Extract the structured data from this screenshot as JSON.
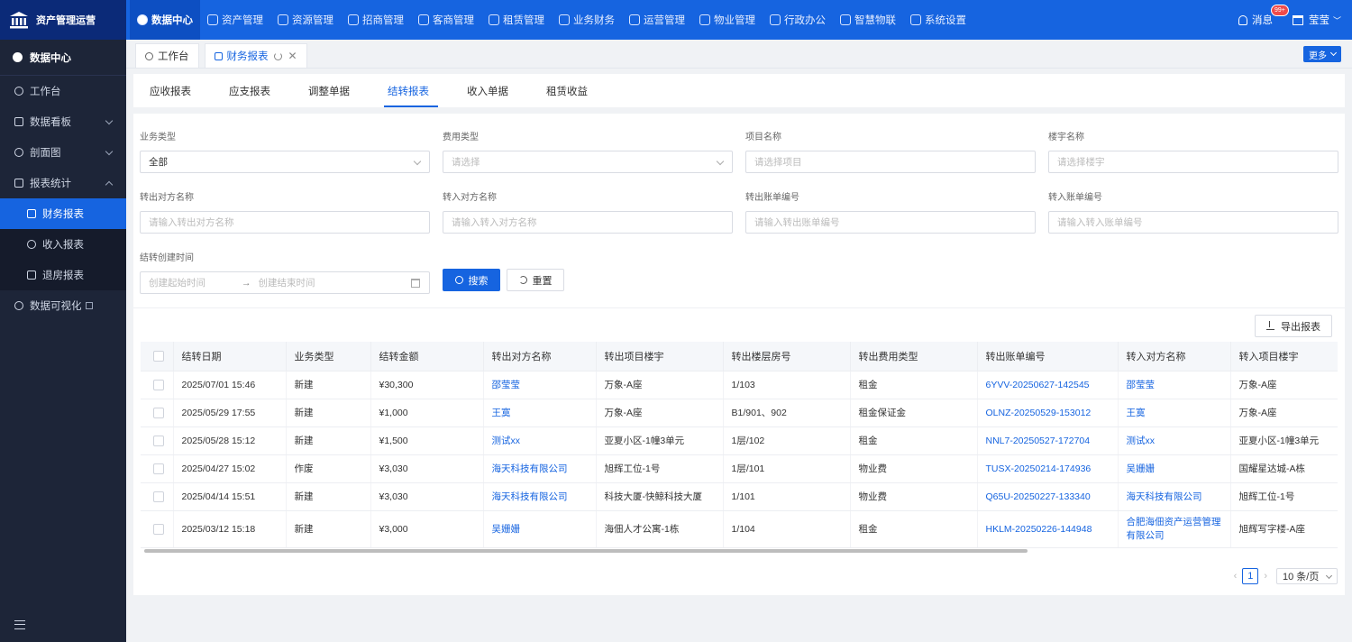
{
  "app": {
    "name": "资产管理运营"
  },
  "topnav": [
    {
      "label": "数据中心",
      "icon": "pie-chart-icon",
      "active": true
    },
    {
      "label": "资产管理",
      "icon": "cube-icon"
    },
    {
      "label": "资源管理",
      "icon": "building-icon"
    },
    {
      "label": "招商管理",
      "icon": "tag-icon"
    },
    {
      "label": "客商管理",
      "icon": "users-icon"
    },
    {
      "label": "租赁管理",
      "icon": "house-icon"
    },
    {
      "label": "业务财务",
      "icon": "coin-icon"
    },
    {
      "label": "运营管理",
      "icon": "image-icon"
    },
    {
      "label": "物业管理",
      "icon": "home-icon"
    },
    {
      "label": "行政办公",
      "icon": "monitor-icon"
    },
    {
      "label": "智慧物联",
      "icon": "network-icon"
    },
    {
      "label": "系统设置",
      "icon": "gear-icon"
    }
  ],
  "header": {
    "messages_label": "消息",
    "badge": "99+",
    "user": "莹莹"
  },
  "sidebar": {
    "title": "数据中心",
    "items": [
      {
        "label": "工作台"
      },
      {
        "label": "数据看板"
      },
      {
        "label": "剖面图"
      },
      {
        "label": "报表统计"
      },
      {
        "label": "财务报表"
      },
      {
        "label": "收入报表"
      },
      {
        "label": "退房报表"
      },
      {
        "label": "数据可视化"
      }
    ]
  },
  "page_tabs": [
    {
      "label": "工作台"
    },
    {
      "label": "财务报表"
    }
  ],
  "more_label": "更多",
  "subtabs": [
    "应收报表",
    "应支报表",
    "调整单据",
    "结转报表",
    "收入单据",
    "租赁收益"
  ],
  "filters": {
    "business_type": {
      "label": "业务类型",
      "value": "全部"
    },
    "fee_type": {
      "label": "费用类型",
      "placeholder": "请选择"
    },
    "project": {
      "label": "项目名称",
      "placeholder": "请选择项目"
    },
    "building": {
      "label": "楼宇名称",
      "placeholder": "请选择楼宇"
    },
    "out_party": {
      "label": "转出对方名称",
      "placeholder": "请输入转出对方名称"
    },
    "in_party": {
      "label": "转入对方名称",
      "placeholder": "请输入转入对方名称"
    },
    "out_bill": {
      "label": "转出账单编号",
      "placeholder": "请输入转出账单编号"
    },
    "in_bill": {
      "label": "转入账单编号",
      "placeholder": "请输入转入账单编号"
    },
    "created_time": {
      "label": "结转创建时间",
      "start_placeholder": "创建起始时间",
      "end_placeholder": "创建结束时间"
    }
  },
  "buttons": {
    "search": "搜索",
    "reset": "重置",
    "export": "导出报表"
  },
  "table": {
    "columns": [
      "结转日期",
      "业务类型",
      "结转金额",
      "转出对方名称",
      "转出项目楼宇",
      "转出楼层房号",
      "转出费用类型",
      "转出账单编号",
      "转入对方名称",
      "转入项目楼宇"
    ],
    "rows": [
      [
        "2025/07/01 15:46",
        "新建",
        "¥30,300",
        "邵莹莹",
        "万象-A座",
        "1/103",
        "租金",
        "6YVV-20250627-142545",
        "邵莹莹",
        "万象-A座"
      ],
      [
        "2025/05/29 17:55",
        "新建",
        "¥1,000",
        "王寞",
        "万象-A座",
        "B1/901、902",
        "租金保证金",
        "OLNZ-20250529-153012",
        "王寞",
        "万象-A座"
      ],
      [
        "2025/05/28 15:12",
        "新建",
        "¥1,500",
        "测试xx",
        "亚夏小区-1幢3单元",
        "1层/102",
        "租金",
        "NNL7-20250527-172704",
        "测试xx",
        "亚夏小区-1幢3单元"
      ],
      [
        "2025/04/27 15:02",
        "作废",
        "¥3,030",
        "海天科技有限公司",
        "旭辉工位-1号",
        "1层/101",
        "物业费",
        "TUSX-20250214-174936",
        "吴姗姗",
        "国耀星达城-A栋"
      ],
      [
        "2025/04/14 15:51",
        "新建",
        "¥3,030",
        "海天科技有限公司",
        "科技大厦-快鲸科技大厦",
        "1/101",
        "物业费",
        "Q65U-20250227-133340",
        "海天科技有限公司",
        "旭辉工位-1号"
      ],
      [
        "2025/03/12 15:18",
        "新建",
        "¥3,000",
        "吴姗姗",
        "海佃人才公寓-1栋",
        "1/104",
        "租金",
        "HKLM-20250226-144948",
        "合肥海佃资产运营管理有限公司",
        "旭辉写字楼-A座"
      ]
    ]
  },
  "pagination": {
    "current": "1",
    "page_size": "10 条/页"
  }
}
